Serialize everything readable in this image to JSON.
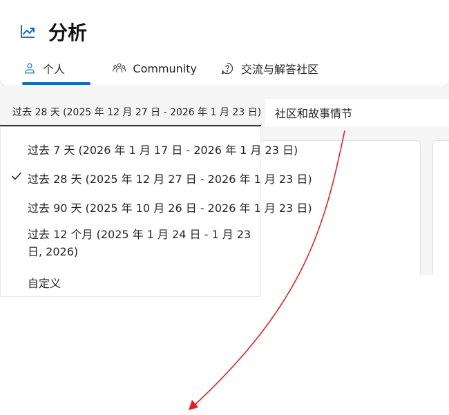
{
  "header": {
    "title": "分析",
    "tabs": [
      {
        "label": "个人",
        "icon": "person-icon",
        "selected": true
      },
      {
        "label": "Community",
        "icon": "people-community-icon"
      },
      {
        "label": "交流与解答社区",
        "icon": "question-chat-icon"
      }
    ]
  },
  "filters": {
    "date_range_value": "过去 28 天 (2025 年 12 月 27 日 - 2026 年 1 月 23 日)",
    "story_box_text": "社区和故事情节"
  },
  "dropdown": {
    "options": [
      {
        "label": "过去 7 天 (2026 年 1 月 17 日 - 2026 年 1 月 23 日)"
      },
      {
        "label": "过去 28 天 (2025 年 12 月 27 日 - 2026 年 1 月 23 日)",
        "selected": true
      },
      {
        "label": "过去 90 天 (2025 年 10 月 26 日 - 2026 年 1 月 23 日)"
      },
      {
        "label": "过去 12 个月 (2025 年 1 月 24 日 - 1 月 23 日, 2026)"
      },
      {
        "label": "自定义"
      }
    ]
  },
  "colors": {
    "accent": "#0f6cbd",
    "annotation_arrow": "#e02020"
  }
}
